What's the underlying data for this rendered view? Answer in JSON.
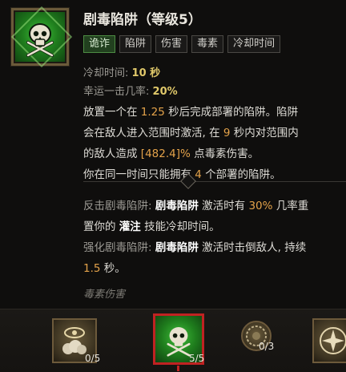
{
  "title": "剧毒陷阱（等级5）",
  "tags": [
    "诡诈",
    "陷阱",
    "伤害",
    "毒素",
    "冷却时间"
  ],
  "stats": {
    "cooldown_label": "冷却时间:",
    "cooldown_value": "10 秒",
    "lucky_label": "幸运一击几率:",
    "lucky_value": "20%"
  },
  "description": {
    "l1_a": "放置一个在",
    "l1_b": "1.25",
    "l1_c": "秒后完成部署的陷阱。陷阱",
    "l2_a": "会在敌人进入范围时激活, 在",
    "l2_b": "9",
    "l2_c": "秒内对范围内",
    "l3_a": "的敌人造成",
    "l3_b": "[482.4]%",
    "l3_c": "点毒素伤害。",
    "l4_a": "你在同一时间只能拥有",
    "l4_b": "4",
    "l4_c": "个部署的陷阱。"
  },
  "modifiers": {
    "m1_label": "反击剧毒陷阱:",
    "m1_name": "剧毒陷阱",
    "m1_a": "激活时有",
    "m1_pct": "30%",
    "m1_b": "几率重",
    "m1_c": "置你的",
    "m1_skill": "灌注",
    "m1_d": "技能冷却时间。",
    "m2_label": "强化剧毒陷阱:",
    "m2_name": "剧毒陷阱",
    "m2_a": "激活时击倒敌人, 持续",
    "m2_num": "1.5",
    "m2_b": "秒。"
  },
  "footer": "毒素伤害",
  "skill_nodes": [
    {
      "icon": "eye-cloud-icon",
      "rank": "0/5"
    },
    {
      "icon": "poison-trap-skull-icon",
      "rank": "5/5",
      "selected": true
    },
    {
      "icon": "round-rune-icon",
      "rank": "0/3"
    },
    {
      "icon": "shuriken-icon",
      "rank": ""
    }
  ],
  "colors": {
    "accent_orange": "#e3a24a",
    "stat_yellow": "#e0c86a",
    "poison_green": "#3fbf3a",
    "selected_red": "#c02222"
  }
}
